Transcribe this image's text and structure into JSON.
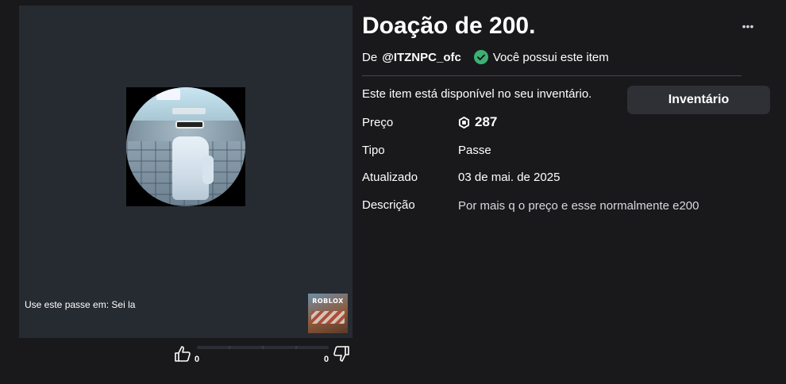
{
  "item": {
    "title": "Doação de 200.",
    "more_label": "•••",
    "by_label": "De",
    "creator": "@ITZNPC_ofc",
    "owned_label": "Você possui este item",
    "available_text": "Este item está disponível no seu inventário.",
    "inventory_button": "Inventário"
  },
  "details": {
    "price_label": "Preço",
    "price_value": "287",
    "type_label": "Tipo",
    "type_value": "Passe",
    "updated_label": "Atualizado",
    "updated_value": "03 de mai. de 2025",
    "description_label": "Descrição",
    "description_value": "Por mais q o preço e esse normalmente e200"
  },
  "media": {
    "use_pass_label": "Use este passe em:",
    "place_name": "Sei la",
    "game_icon_text": "ROBLOX"
  },
  "votes": {
    "up_count": "0",
    "down_count": "0"
  },
  "colors": {
    "background": "#19191c",
    "panel": "#262a31",
    "owned_green": "#3bb273",
    "button_bg": "#2e3036"
  },
  "icons": {
    "more": "more-dots-icon",
    "owned": "check-circle-icon",
    "currency": "robux-icon",
    "upvote": "thumbs-up-icon",
    "downvote": "thumbs-down-icon"
  }
}
